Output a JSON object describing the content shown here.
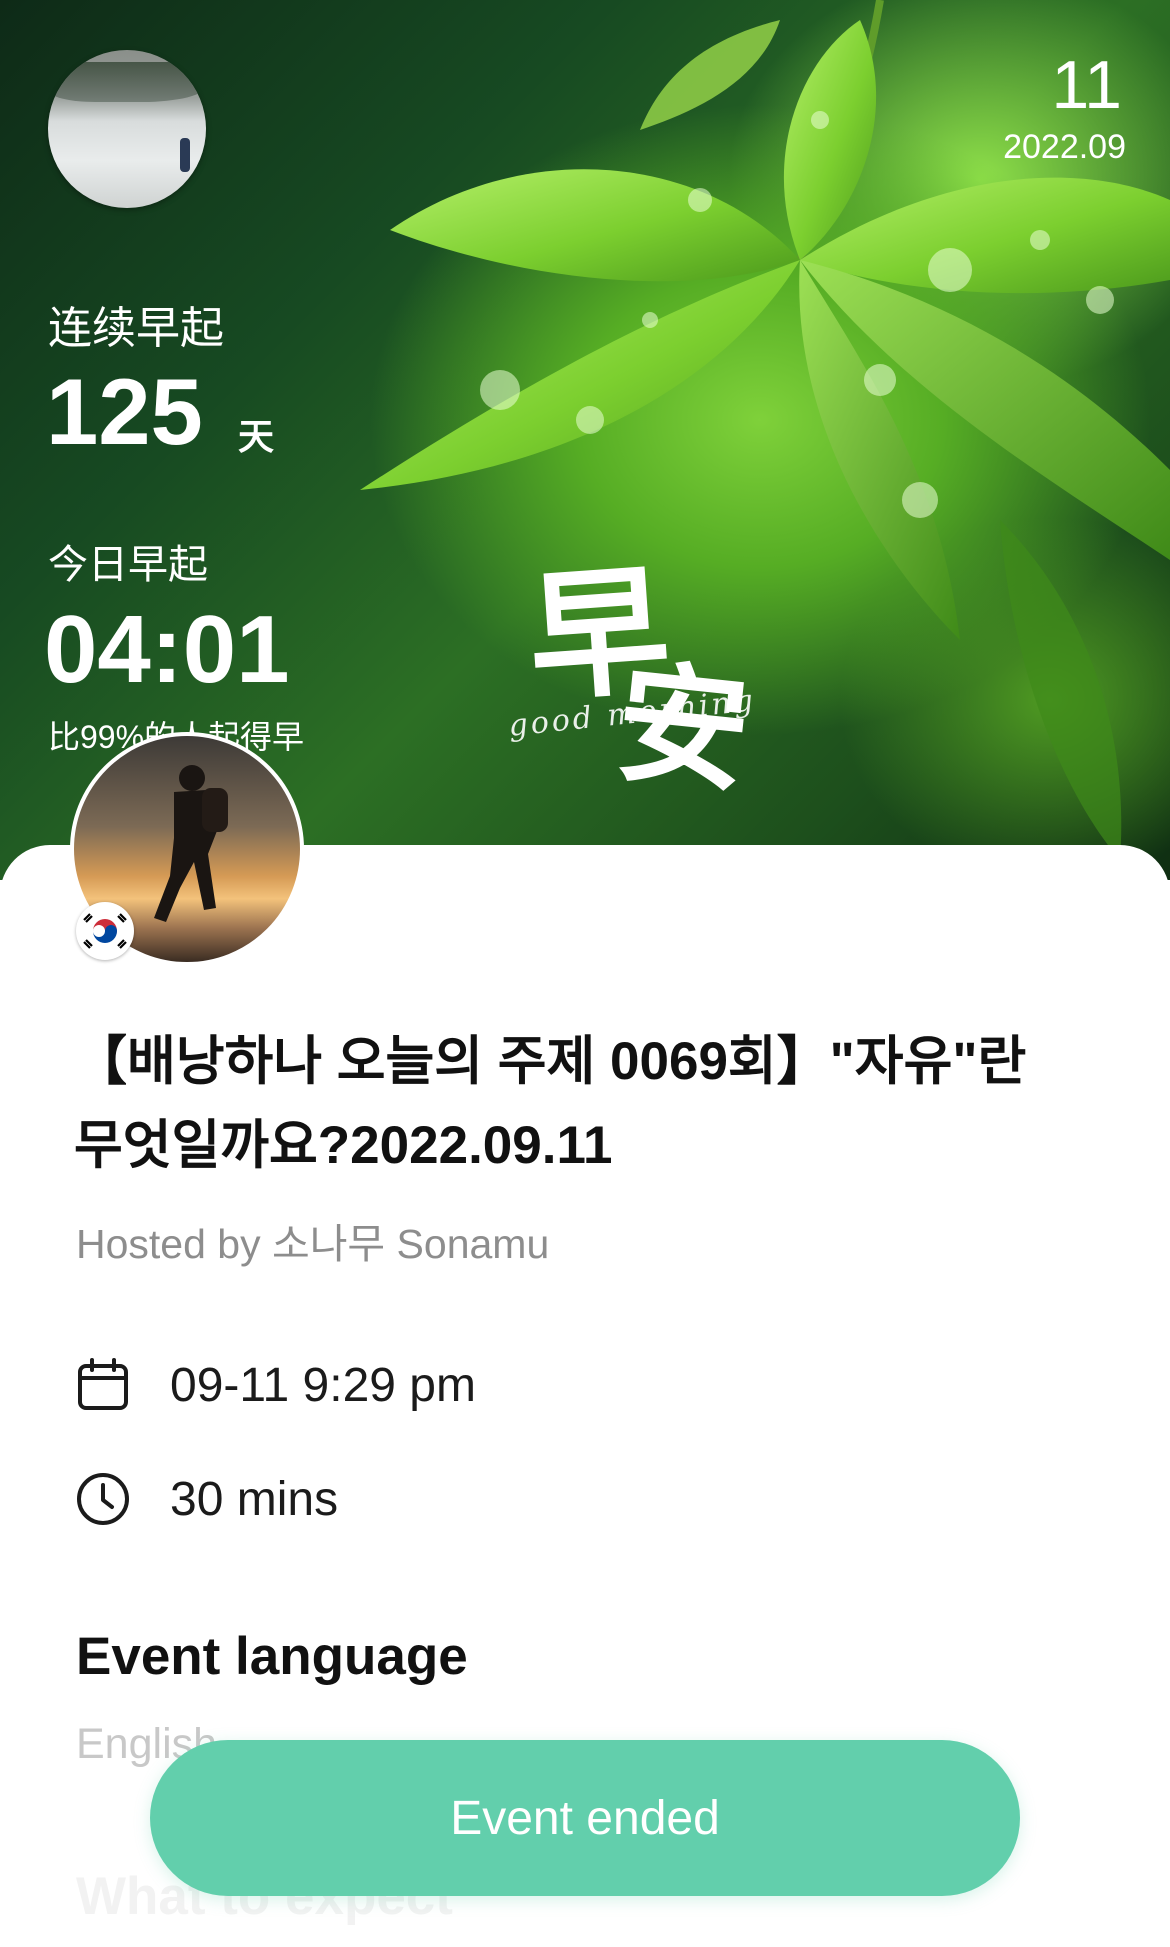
{
  "banner": {
    "date_day": "11",
    "date_month": "2022.09",
    "streak_label": "连续早起",
    "streak_count": "125",
    "streak_unit": "天",
    "today_label": "今日早起",
    "today_time": "04:01",
    "compare_text": "比99%的人起得早",
    "greeting_line1": "早",
    "greeting_line2": "安",
    "greeting_en": "good morning"
  },
  "event": {
    "title": "【배낭하나 오늘의 주제 0069회】\"자유\"란 무엇일까요?2022.09.11",
    "host": "Hosted by 소나무 Sonamu",
    "datetime": "09-11 9:29 pm",
    "duration": "30 mins",
    "language_heading": "Event language",
    "language_value": "English",
    "expect_heading": "What to expect"
  },
  "actions": {
    "status_button": "Event ended"
  },
  "colors": {
    "accent": "#62cfac",
    "muted_text": "#8d8d8d"
  },
  "icons": {
    "calendar": "calendar-icon",
    "clock": "clock-icon",
    "flag": "korea-flag-icon"
  }
}
